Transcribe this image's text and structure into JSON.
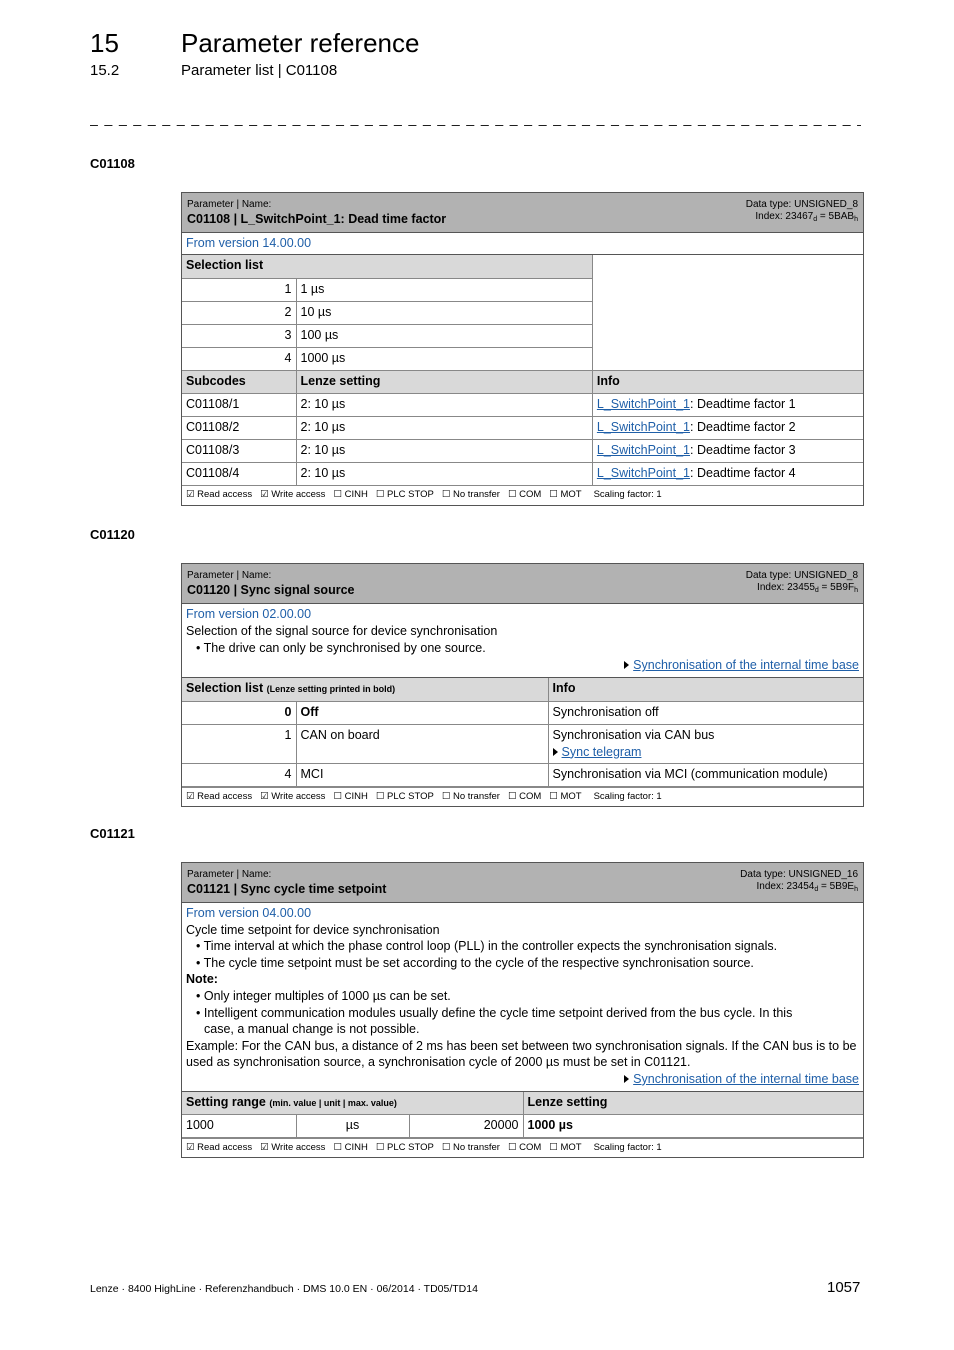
{
  "header": {
    "chapter_number": "15",
    "chapter_title": "Parameter reference",
    "section_number": "15.2",
    "section_title": "Parameter list | C01108",
    "separator": "_ _ _ _ _ _ _ _ _ _ _ _ _ _ _ _ _ _ _ _ _ _ _ _ _ _ _ _ _ _ _ _ _ _ _ _ _ _ _ _ _ _ _ _ _ _ _ _ _ _ _ _ _ _ _ _ _ _ _ _ _ _ _ _"
  },
  "common": {
    "param_name_label": "Parameter | Name:",
    "footer": {
      "read": "☑ Read access",
      "write": "☑ Write access",
      "cinh": "☐ CINH",
      "plc": "☐ PLC STOP",
      "notransfer": "☐ No transfer",
      "com": "☐ COM",
      "mot": "☐ MOT",
      "scaling": "Scaling factor: 1"
    }
  },
  "c01108": {
    "section_label": "C01108",
    "title": "C01108 | L_SwitchPoint_1: Dead time factor",
    "data_type": "Data type: UNSIGNED_8",
    "index_prefix": "Index: 23467",
    "index_d": "d",
    "index_mid": " = 5BAB",
    "index_h": "h",
    "version": "From version 14.00.00",
    "selection_header": "Selection list",
    "selection": [
      {
        "value": "1",
        "label": "1 µs"
      },
      {
        "value": "2",
        "label": "10 µs"
      },
      {
        "value": "3",
        "label": "100 µs"
      },
      {
        "value": "4",
        "label": "1000 µs"
      }
    ],
    "sub_headers": {
      "subcodes": "Subcodes",
      "lenze": "Lenze setting",
      "info": "Info"
    },
    "subcodes": [
      {
        "code": "C01108/1",
        "setting": "2: 10 µs",
        "link": "L_SwitchPoint_1",
        "info": ": Deadtime factor 1"
      },
      {
        "code": "C01108/2",
        "setting": "2: 10 µs",
        "link": "L_SwitchPoint_1",
        "info": ": Deadtime factor 2"
      },
      {
        "code": "C01108/3",
        "setting": "2: 10 µs",
        "link": "L_SwitchPoint_1",
        "info": ": Deadtime factor 3"
      },
      {
        "code": "C01108/4",
        "setting": "2: 10 µs",
        "link": "L_SwitchPoint_1",
        "info": ": Deadtime factor 4"
      }
    ]
  },
  "c01120": {
    "section_label": "C01120",
    "title": "C01120 | Sync signal source",
    "data_type": "Data type: UNSIGNED_8",
    "index_prefix": "Index: 23455",
    "index_d": "d",
    "index_mid": " = 5B9F",
    "index_h": "h",
    "version": "From version 02.00.00",
    "description": "Selection of the signal source for device synchronisation",
    "bullet": "• The drive can only be synchronised by one source.",
    "link": "Synchronisation of the internal time base",
    "selection_header": "Selection list",
    "selection_note": "(Lenze setting printed in bold)",
    "info_header": "Info",
    "selection": [
      {
        "value": "0",
        "label": "Off",
        "info": "Synchronisation off"
      },
      {
        "value": "1",
        "label": "CAN on board",
        "info": "Synchronisation via CAN bus",
        "info_link": "Sync telegram"
      },
      {
        "value": "4",
        "label": "MCI",
        "info": "Synchronisation via MCI (communication module)"
      }
    ]
  },
  "c01121": {
    "section_label": "C01121",
    "title": "C01121 | Sync cycle time setpoint",
    "data_type": "Data type: UNSIGNED_16",
    "index_prefix": "Index: 23454",
    "index_d": "d",
    "index_mid": " = 5B9E",
    "index_h": "h",
    "version": "From version 04.00.00",
    "description": "Cycle time setpoint for device synchronisation",
    "bullets": [
      "• Time interval at which the phase control loop (PLL) in the controller expects the synchronisation signals.",
      "• The cycle time setpoint must be set according to the cycle of the respective synchronisation source."
    ],
    "note_label": "Note:",
    "note_bullets": [
      "• Only integer multiples of 1000 µs can be set.",
      "• Intelligent communication modules usually define the cycle time setpoint derived from the bus cycle. In this",
      "case, a manual change is not possible."
    ],
    "example": "Example: For the CAN bus, a distance of 2 ms has been set between two synchronisation signals. If the CAN bus is to be used as synchronisation source, a synchronisation cycle of 2000 µs must be set in C01121.",
    "link": "Synchronisation of the internal time base",
    "range_header": "Setting range",
    "range_note": "(min. value | unit | max. value)",
    "lenze_header": "Lenze setting",
    "min": "1000",
    "unit": "µs",
    "max": "20000",
    "lenze_value": "1000 µs"
  },
  "page_footer": {
    "doc": "Lenze · 8400 HighLine · Referenzhandbuch · DMS 10.0 EN · 06/2014 · TD05/TD14",
    "page": "1057"
  }
}
